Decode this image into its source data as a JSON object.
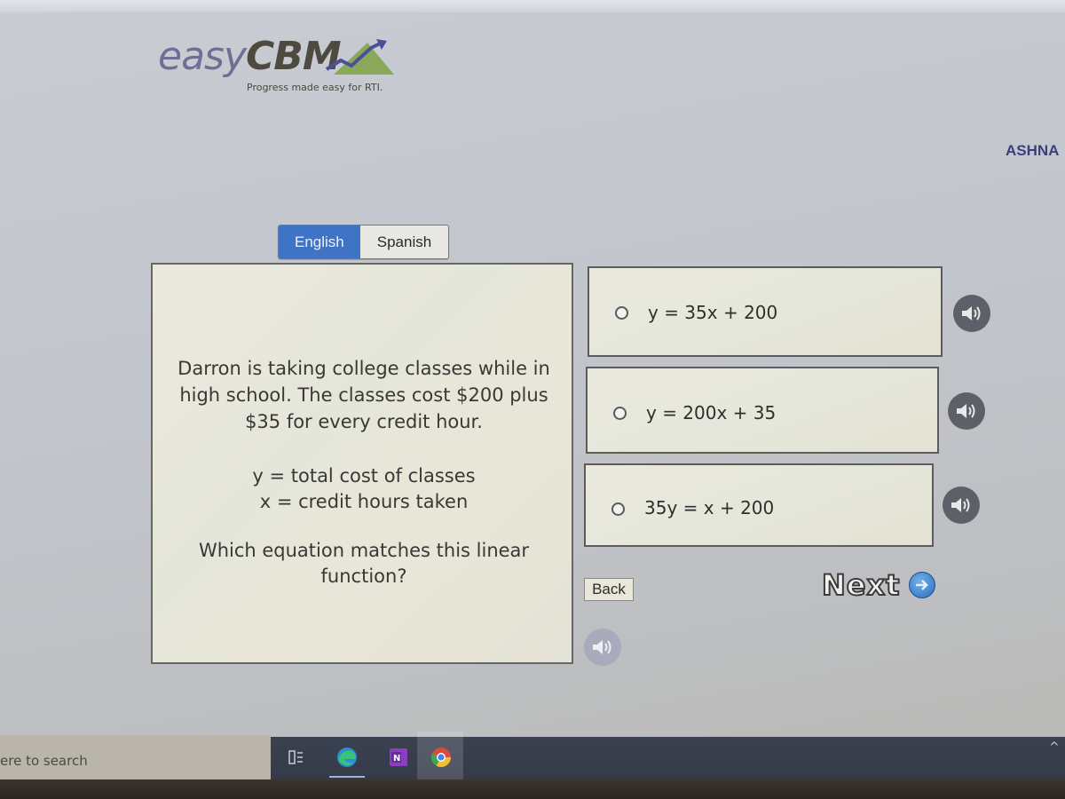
{
  "header": {
    "logo_easy": "easy",
    "logo_cbm": "CBM",
    "tagline": "Progress made easy for RTI.",
    "user_name": "ASHNA"
  },
  "language": {
    "options": [
      "English",
      "Spanish"
    ],
    "selected": "English"
  },
  "question": {
    "prompt": "Darron is taking college classes while in high school. The classes cost $200 plus $35 for every credit hour.",
    "definitions": [
      "y = total cost of classes",
      "x = credit hours taken"
    ],
    "ask": "Which equation matches this linear function?"
  },
  "choices": [
    {
      "label": "y = 35x + 200",
      "selected": false,
      "audio_icon": "speaker-icon"
    },
    {
      "label": "y = 200x + 35",
      "selected": false,
      "audio_icon": "speaker-icon"
    },
    {
      "label": "35y = x + 200",
      "selected": false,
      "audio_icon": "speaker-icon"
    }
  ],
  "navigation": {
    "back_label": "Back",
    "next_label": "Next",
    "question_audio_icon": "speaker-icon"
  },
  "taskbar": {
    "search_placeholder": "ere to search",
    "apps": [
      "task-view",
      "edge",
      "onenote",
      "chrome"
    ],
    "active_app": "chrome"
  },
  "colors": {
    "english_active": "#3f73c5",
    "next_arrow": "#2f6fbf",
    "taskbar": "#363c4a"
  }
}
